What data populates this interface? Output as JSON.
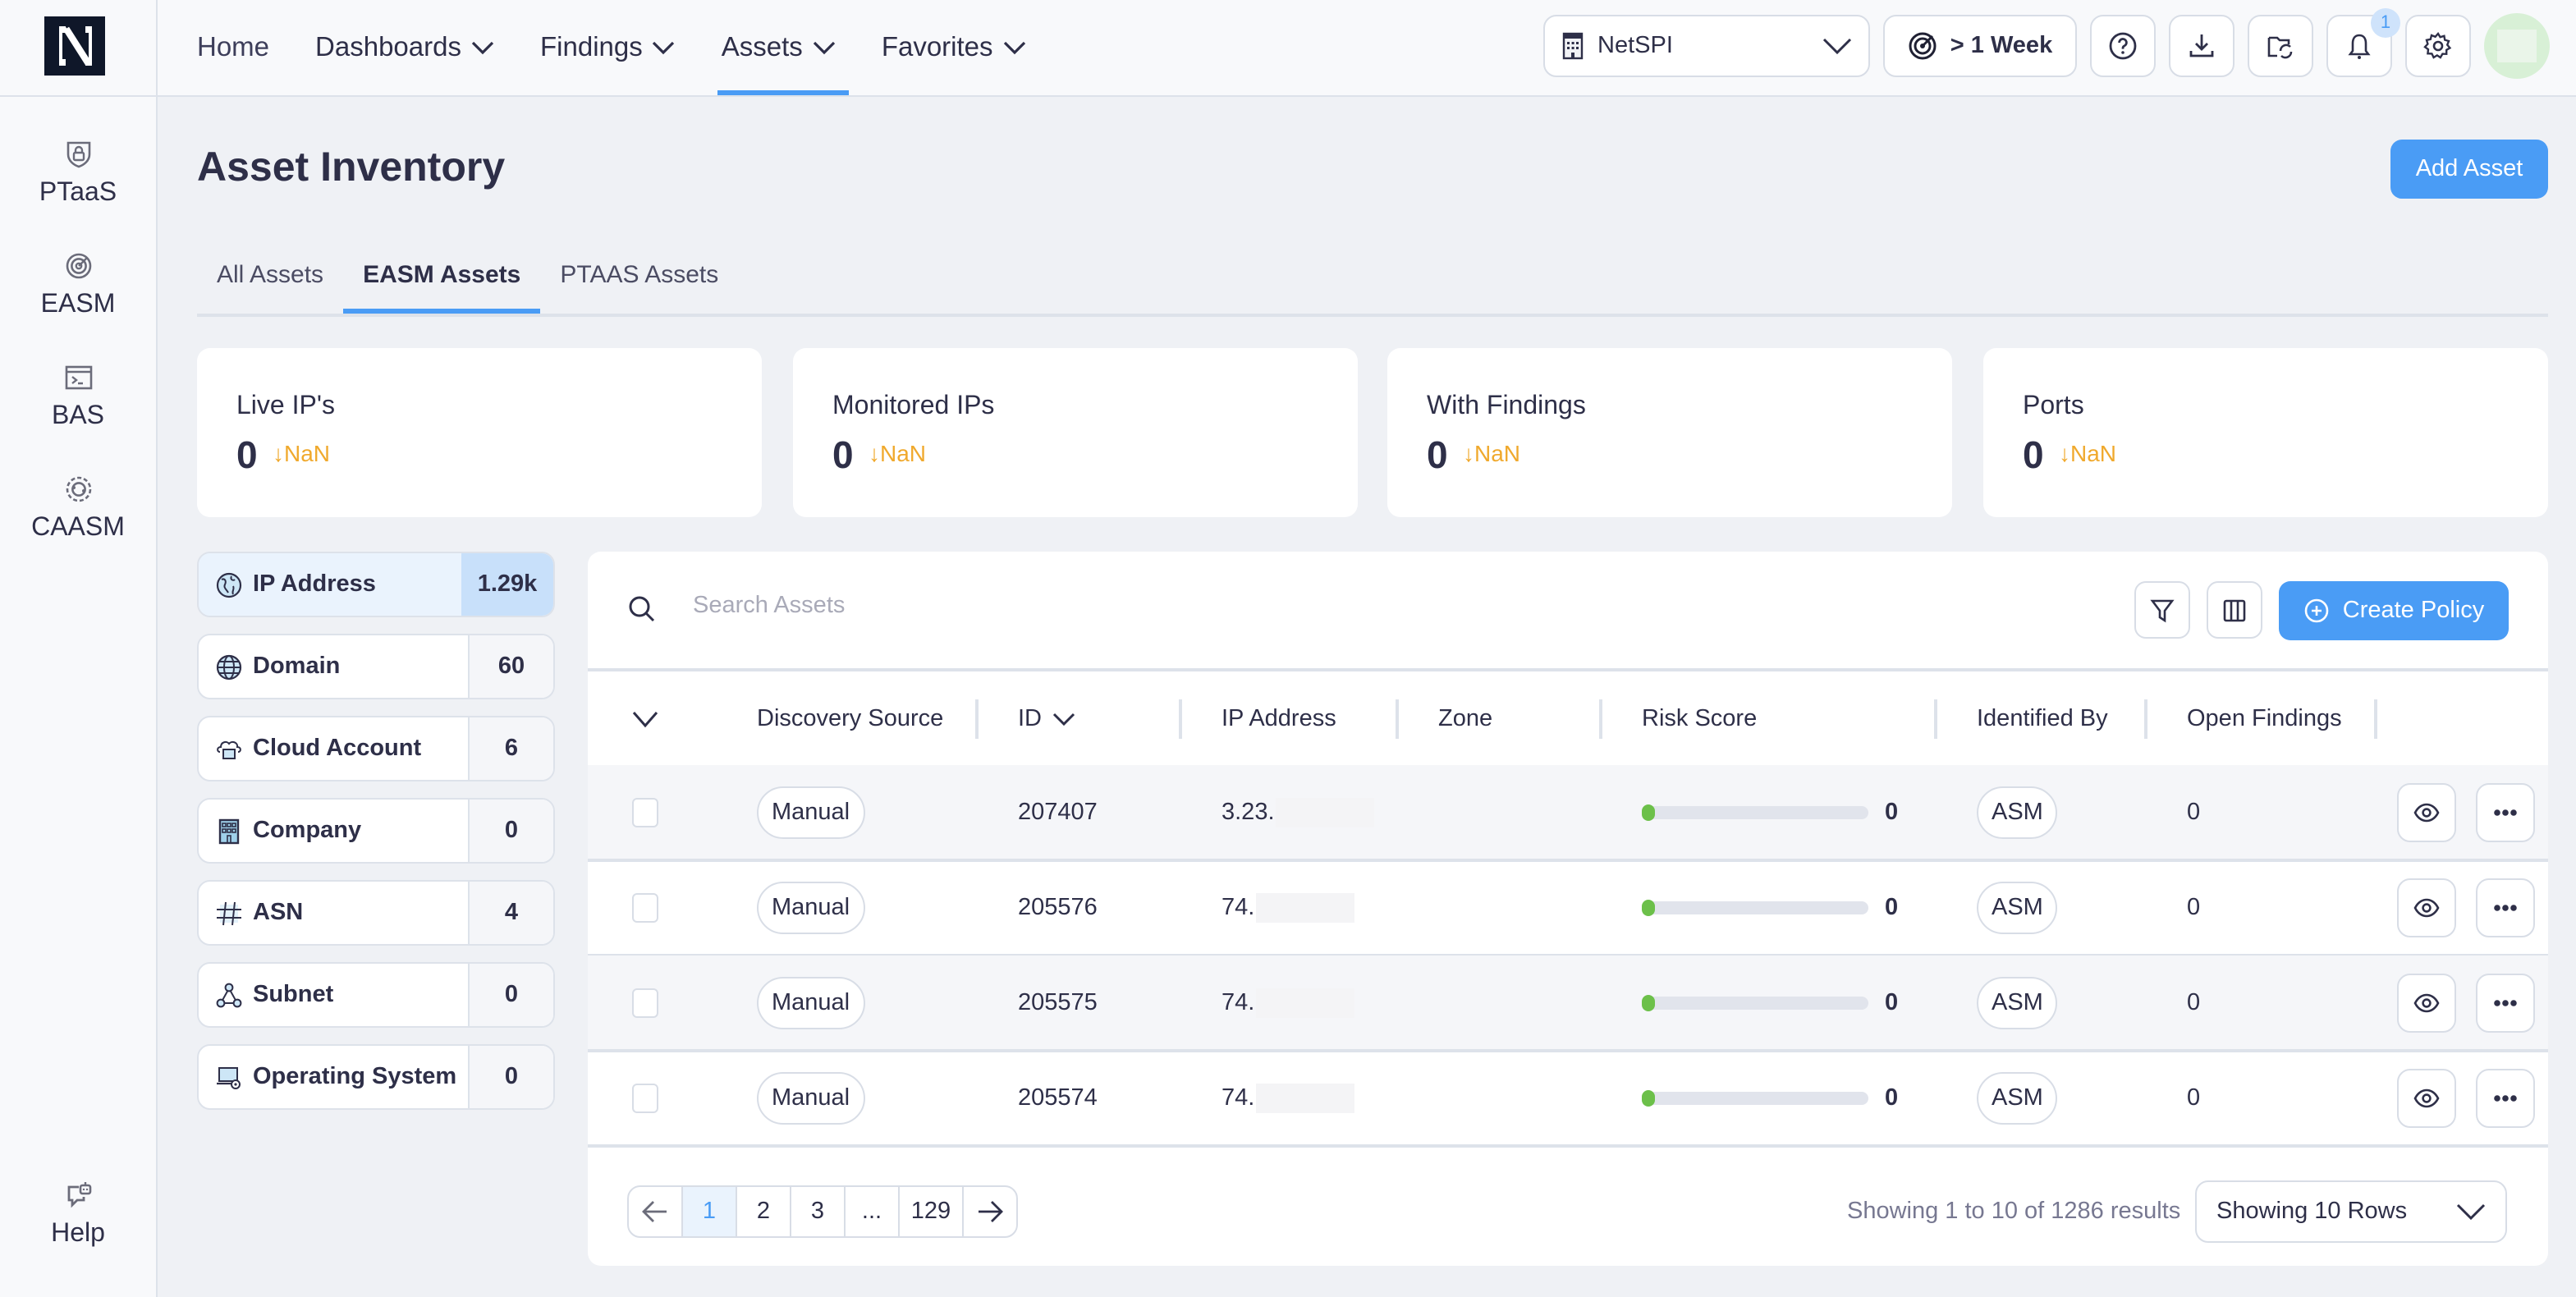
{
  "topnav": {
    "items": [
      {
        "label": "Home",
        "has_dropdown": false,
        "active": false
      },
      {
        "label": "Dashboards",
        "has_dropdown": true,
        "active": false
      },
      {
        "label": "Findings",
        "has_dropdown": true,
        "active": false
      },
      {
        "label": "Assets",
        "has_dropdown": true,
        "active": true
      },
      {
        "label": "Favorites",
        "has_dropdown": true,
        "active": false
      }
    ],
    "org_select": "NetSPI",
    "time_range": "> 1 Week",
    "notification_count": "1",
    "icons": [
      "help-icon",
      "download-icon",
      "folder-sync-icon",
      "bell-icon",
      "gear-icon"
    ]
  },
  "sidebar": {
    "items": [
      {
        "label": "PTaaS",
        "icon": "shield-lock-icon"
      },
      {
        "label": "EASM",
        "icon": "target-radar-icon"
      },
      {
        "label": "BAS",
        "icon": "terminal-icon"
      },
      {
        "label": "CAASM",
        "icon": "orbit-icon"
      }
    ],
    "help_label": "Help"
  },
  "page": {
    "title": "Asset Inventory",
    "add_asset_label": "Add Asset",
    "tabs": [
      {
        "label": "All Assets",
        "active": false
      },
      {
        "label": "EASM Assets",
        "active": true
      },
      {
        "label": "PTAAS Assets",
        "active": false
      }
    ]
  },
  "stats": [
    {
      "title": "Live IP's",
      "value": "0",
      "delta": "NaN"
    },
    {
      "title": "Monitored IPs",
      "value": "0",
      "delta": "NaN"
    },
    {
      "title": "With Findings",
      "value": "0",
      "delta": "NaN"
    },
    {
      "title": "Ports",
      "value": "0",
      "delta": "NaN"
    }
  ],
  "asset_types": [
    {
      "label": "IP Address",
      "count": "1.29k",
      "icon": "ip-globe-icon",
      "active": true
    },
    {
      "label": "Domain",
      "count": "60",
      "icon": "globe-icon",
      "active": false
    },
    {
      "label": "Cloud Account",
      "count": "6",
      "icon": "cloud-folder-icon",
      "active": false
    },
    {
      "label": "Company",
      "count": "0",
      "icon": "building-icon",
      "active": false
    },
    {
      "label": "ASN",
      "count": "4",
      "icon": "hash-icon",
      "active": false
    },
    {
      "label": "Subnet",
      "count": "0",
      "icon": "network-nodes-icon",
      "active": false
    },
    {
      "label": "Operating System",
      "count": "0",
      "icon": "laptop-gear-icon",
      "active": false
    }
  ],
  "table": {
    "search_placeholder": "Search Assets",
    "create_policy_label": "Create Policy",
    "columns": [
      "Discovery Source",
      "ID",
      "IP Address",
      "Zone",
      "Risk Score",
      "Identified By",
      "Open Findings"
    ],
    "rows": [
      {
        "discovery_source": "Manual",
        "id": "207407",
        "ip_prefix": "3.23.",
        "zone": "",
        "risk_score": "0",
        "risk_fraction": 0,
        "identified_by": "ASM",
        "open_findings": "0"
      },
      {
        "discovery_source": "Manual",
        "id": "205576",
        "ip_prefix": "74.",
        "zone": "",
        "risk_score": "0",
        "risk_fraction": 0,
        "identified_by": "ASM",
        "open_findings": "0"
      },
      {
        "discovery_source": "Manual",
        "id": "205575",
        "ip_prefix": "74.",
        "zone": "",
        "risk_score": "0",
        "risk_fraction": 0,
        "identified_by": "ASM",
        "open_findings": "0"
      },
      {
        "discovery_source": "Manual",
        "id": "205574",
        "ip_prefix": "74.",
        "zone": "",
        "risk_score": "0",
        "risk_fraction": 0,
        "identified_by": "ASM",
        "open_findings": "0"
      }
    ]
  },
  "pagination": {
    "pages": [
      "1",
      "2",
      "3",
      "...",
      "129"
    ],
    "current": "1",
    "results_text": "Showing 1 to 10 of 1286 results",
    "rows_select": "Showing 10 Rows"
  },
  "colors": {
    "accent": "#4a9cf5",
    "delta": "#f0a92d",
    "risk_low": "#6cc04a"
  }
}
